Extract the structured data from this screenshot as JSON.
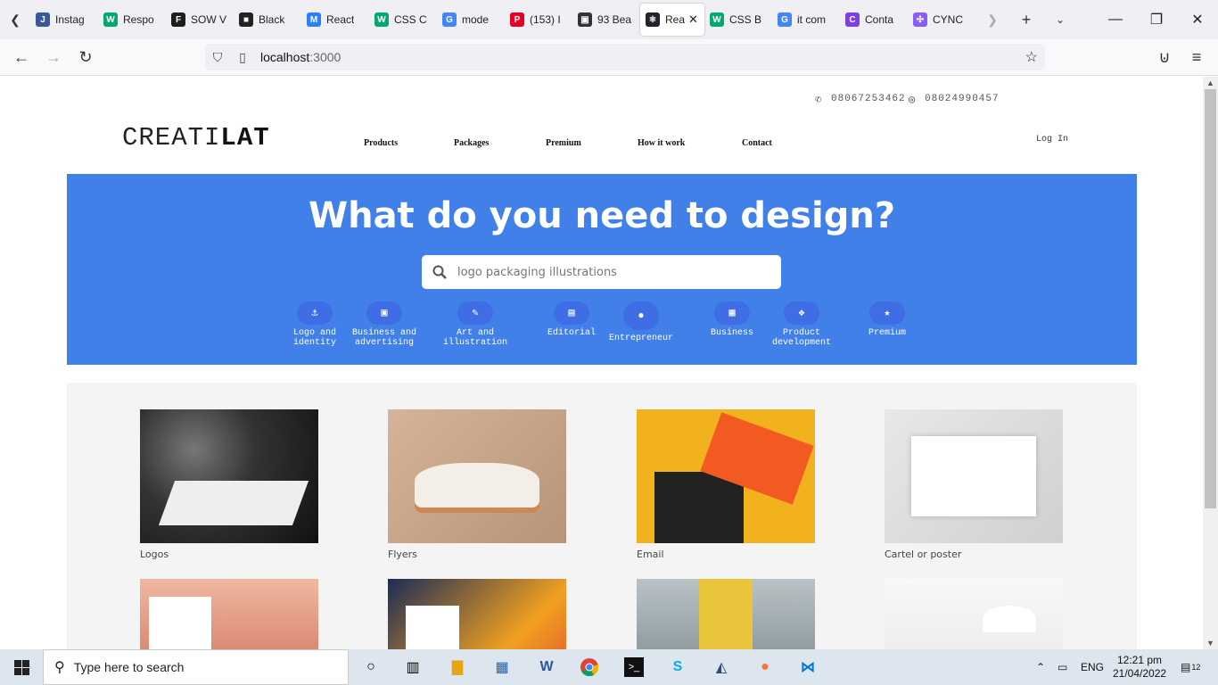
{
  "browser": {
    "tabs": [
      {
        "label": "Instag",
        "color": "#3b5998",
        "glyph": "J"
      },
      {
        "label": "Respo",
        "color": "#04aa6d",
        "glyph": "W"
      },
      {
        "label": "SOW V",
        "color": "#1e1e1e",
        "glyph": "F"
      },
      {
        "label": "Black",
        "color": "#222222",
        "glyph": "■"
      },
      {
        "label": "React",
        "color": "#2d7ff9",
        "glyph": "M"
      },
      {
        "label": "CSS C",
        "color": "#04aa6d",
        "glyph": "W"
      },
      {
        "label": "mode",
        "color": "#4285f4",
        "glyph": "G"
      },
      {
        "label": "(153) I",
        "color": "#e60023",
        "glyph": "P"
      },
      {
        "label": "93 Bea",
        "color": "#333333",
        "glyph": "▣"
      },
      {
        "label": "Rea",
        "color": "#20232a",
        "glyph": "⚛",
        "active": true
      },
      {
        "label": "CSS B",
        "color": "#04aa6d",
        "glyph": "W"
      },
      {
        "label": "it com",
        "color": "#4285f4",
        "glyph": "G"
      },
      {
        "label": "Conta",
        "color": "#7b3fe4",
        "glyph": "C"
      },
      {
        "label": "CYNC",
        "color": "#8a5cf6",
        "glyph": "✣"
      }
    ],
    "url_host": "localhost",
    "url_port": ":3000"
  },
  "contact": {
    "phone": "08067253462",
    "whatsapp": "08024990457"
  },
  "logo": {
    "light": "CREATI",
    "bold": "LAT"
  },
  "nav": {
    "products": "Products",
    "packages": "Packages",
    "premium": "Premium",
    "how_it_work": "How it work",
    "contact": "Contact",
    "login": "Log In"
  },
  "hero": {
    "title": "What do you need to design?",
    "search_placeholder": "logo packaging illustrations",
    "categories": [
      {
        "line1": "Logo and",
        "line2": "identity",
        "icon": "anchor-icon",
        "glyph": "⚓"
      },
      {
        "line1": "Business and",
        "line2": "advertising",
        "icon": "briefcase-icon",
        "glyph": "▣"
      },
      {
        "line1": "Art and",
        "line2": "illustration",
        "icon": "pencil-icon",
        "glyph": "✎"
      },
      {
        "line1": "Editorial",
        "line2": "",
        "icon": "book-icon",
        "glyph": "▤"
      },
      {
        "line1": "Entrepreneur",
        "line2": "",
        "icon": "lightbulb-icon",
        "glyph": "●"
      },
      {
        "line1": "Business",
        "line2": "",
        "icon": "cash-icon",
        "glyph": "▦"
      },
      {
        "line1": "Product",
        "line2": "development",
        "icon": "cubes-icon",
        "glyph": "❖"
      },
      {
        "line1": "Premium",
        "line2": "",
        "icon": "star-icon",
        "glyph": "★"
      }
    ]
  },
  "gallery": [
    {
      "caption": "Logos"
    },
    {
      "caption": "Flyers"
    },
    {
      "caption": "Email"
    },
    {
      "caption": "Cartel or poster"
    },
    {
      "caption": ""
    },
    {
      "caption": ""
    },
    {
      "caption": ""
    },
    {
      "caption": ""
    }
  ],
  "taskbar": {
    "search_placeholder": "Type here to search",
    "lang": "ENG",
    "time": "12:21 pm",
    "date": "21/04/2022",
    "notifications": "12"
  },
  "colors": {
    "hero": "#4080e8",
    "category_bubble": "#3e6de6"
  }
}
